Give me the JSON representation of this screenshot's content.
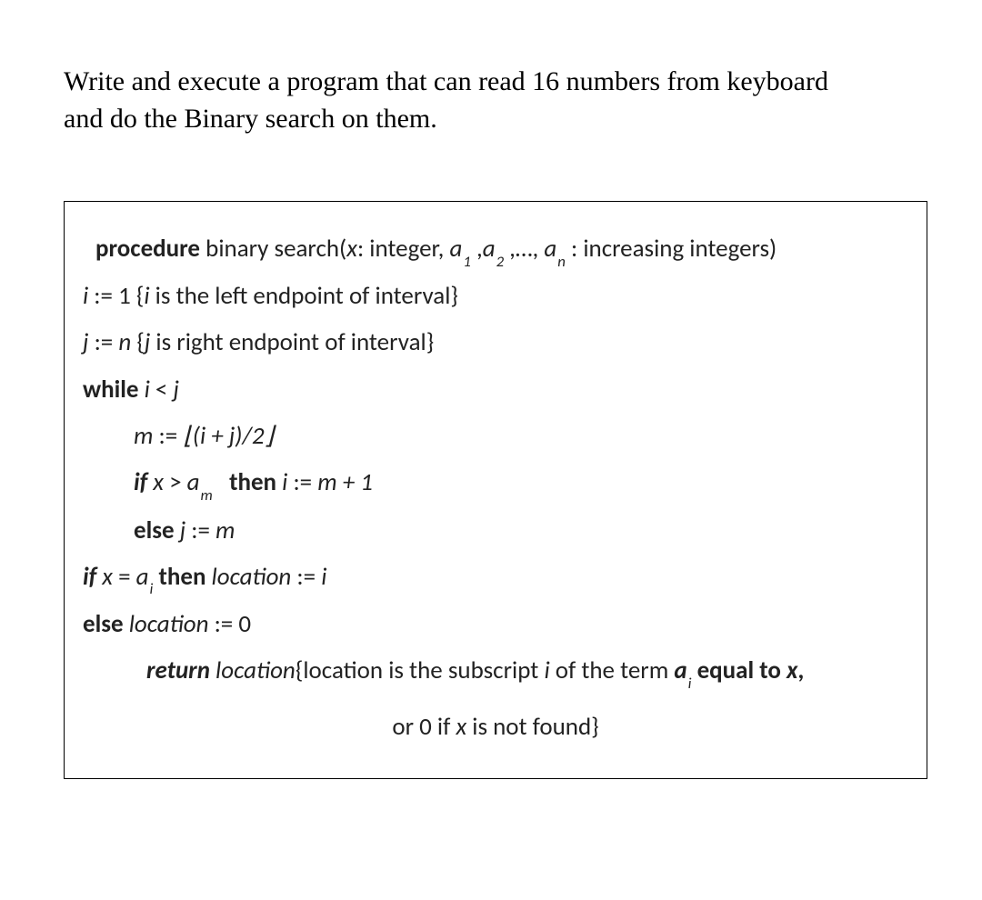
{
  "prompt_line1": "Write and execute a program that can read 16 numbers from keyboard",
  "prompt_line2": "and do the Binary search on them.",
  "pseudo": {
    "kw_procedure": "procedure",
    "proc_name": " binary search(",
    "sig_x": "x",
    "sig_colon_int": ": integer, ",
    "sig_a": "a",
    "sig_comma1": "  ,",
    "sig_a2": "a",
    "sig_comma2": "  ,…, ",
    "sig_a3": "a",
    "sig_colon_inc": "  : increasing integers)",
    "sub1": "1",
    "sub2": "2",
    "subn": "n",
    "l_i": "i",
    "assign": " := ",
    "one": "1 {",
    "i_comment_i": "i",
    "i_comment_rest": " is the left endpoint of interval}",
    "l_j": "j",
    "j_rhs_n": "n",
    "j_open": " {",
    "j_comment_j": "j",
    "j_comment_rest": " is right endpoint of interval}",
    "kw_while": "while",
    "while_i": " i ",
    "lt": "< ",
    "while_j": "j",
    "l_m": "m",
    "m_rhs": "⌊(i + j)/2⌋",
    "kw_if": "if",
    "if_x": " x ",
    "gt": "> ",
    "if_a": "a",
    "subm": "m",
    "kw_then": "then",
    "then_i": " i ",
    "m_plus1": "m + 1",
    "kw_else": "else",
    "else_j": " j ",
    "else_m": "m",
    "if2_x": " x ",
    "eq": "= ",
    "if2_a": "a",
    "subi": "i",
    "then_loc": " location ",
    "loc_i": "i",
    "else_loc": " location ",
    "zero": "0",
    "kw_return": "return",
    "ret_loc": " location",
    "ret_open": "{location is the subscript ",
    "ret_i": "i",
    "ret_mid": " of the term ",
    "ret_a": "a",
    "ret_eq": "  equal to  ",
    "ret_x": "x",
    "ret_comma": ",",
    "or_line_pre": "or 0 if ",
    "or_line_x": "x",
    "or_line_post": " is not found}"
  }
}
